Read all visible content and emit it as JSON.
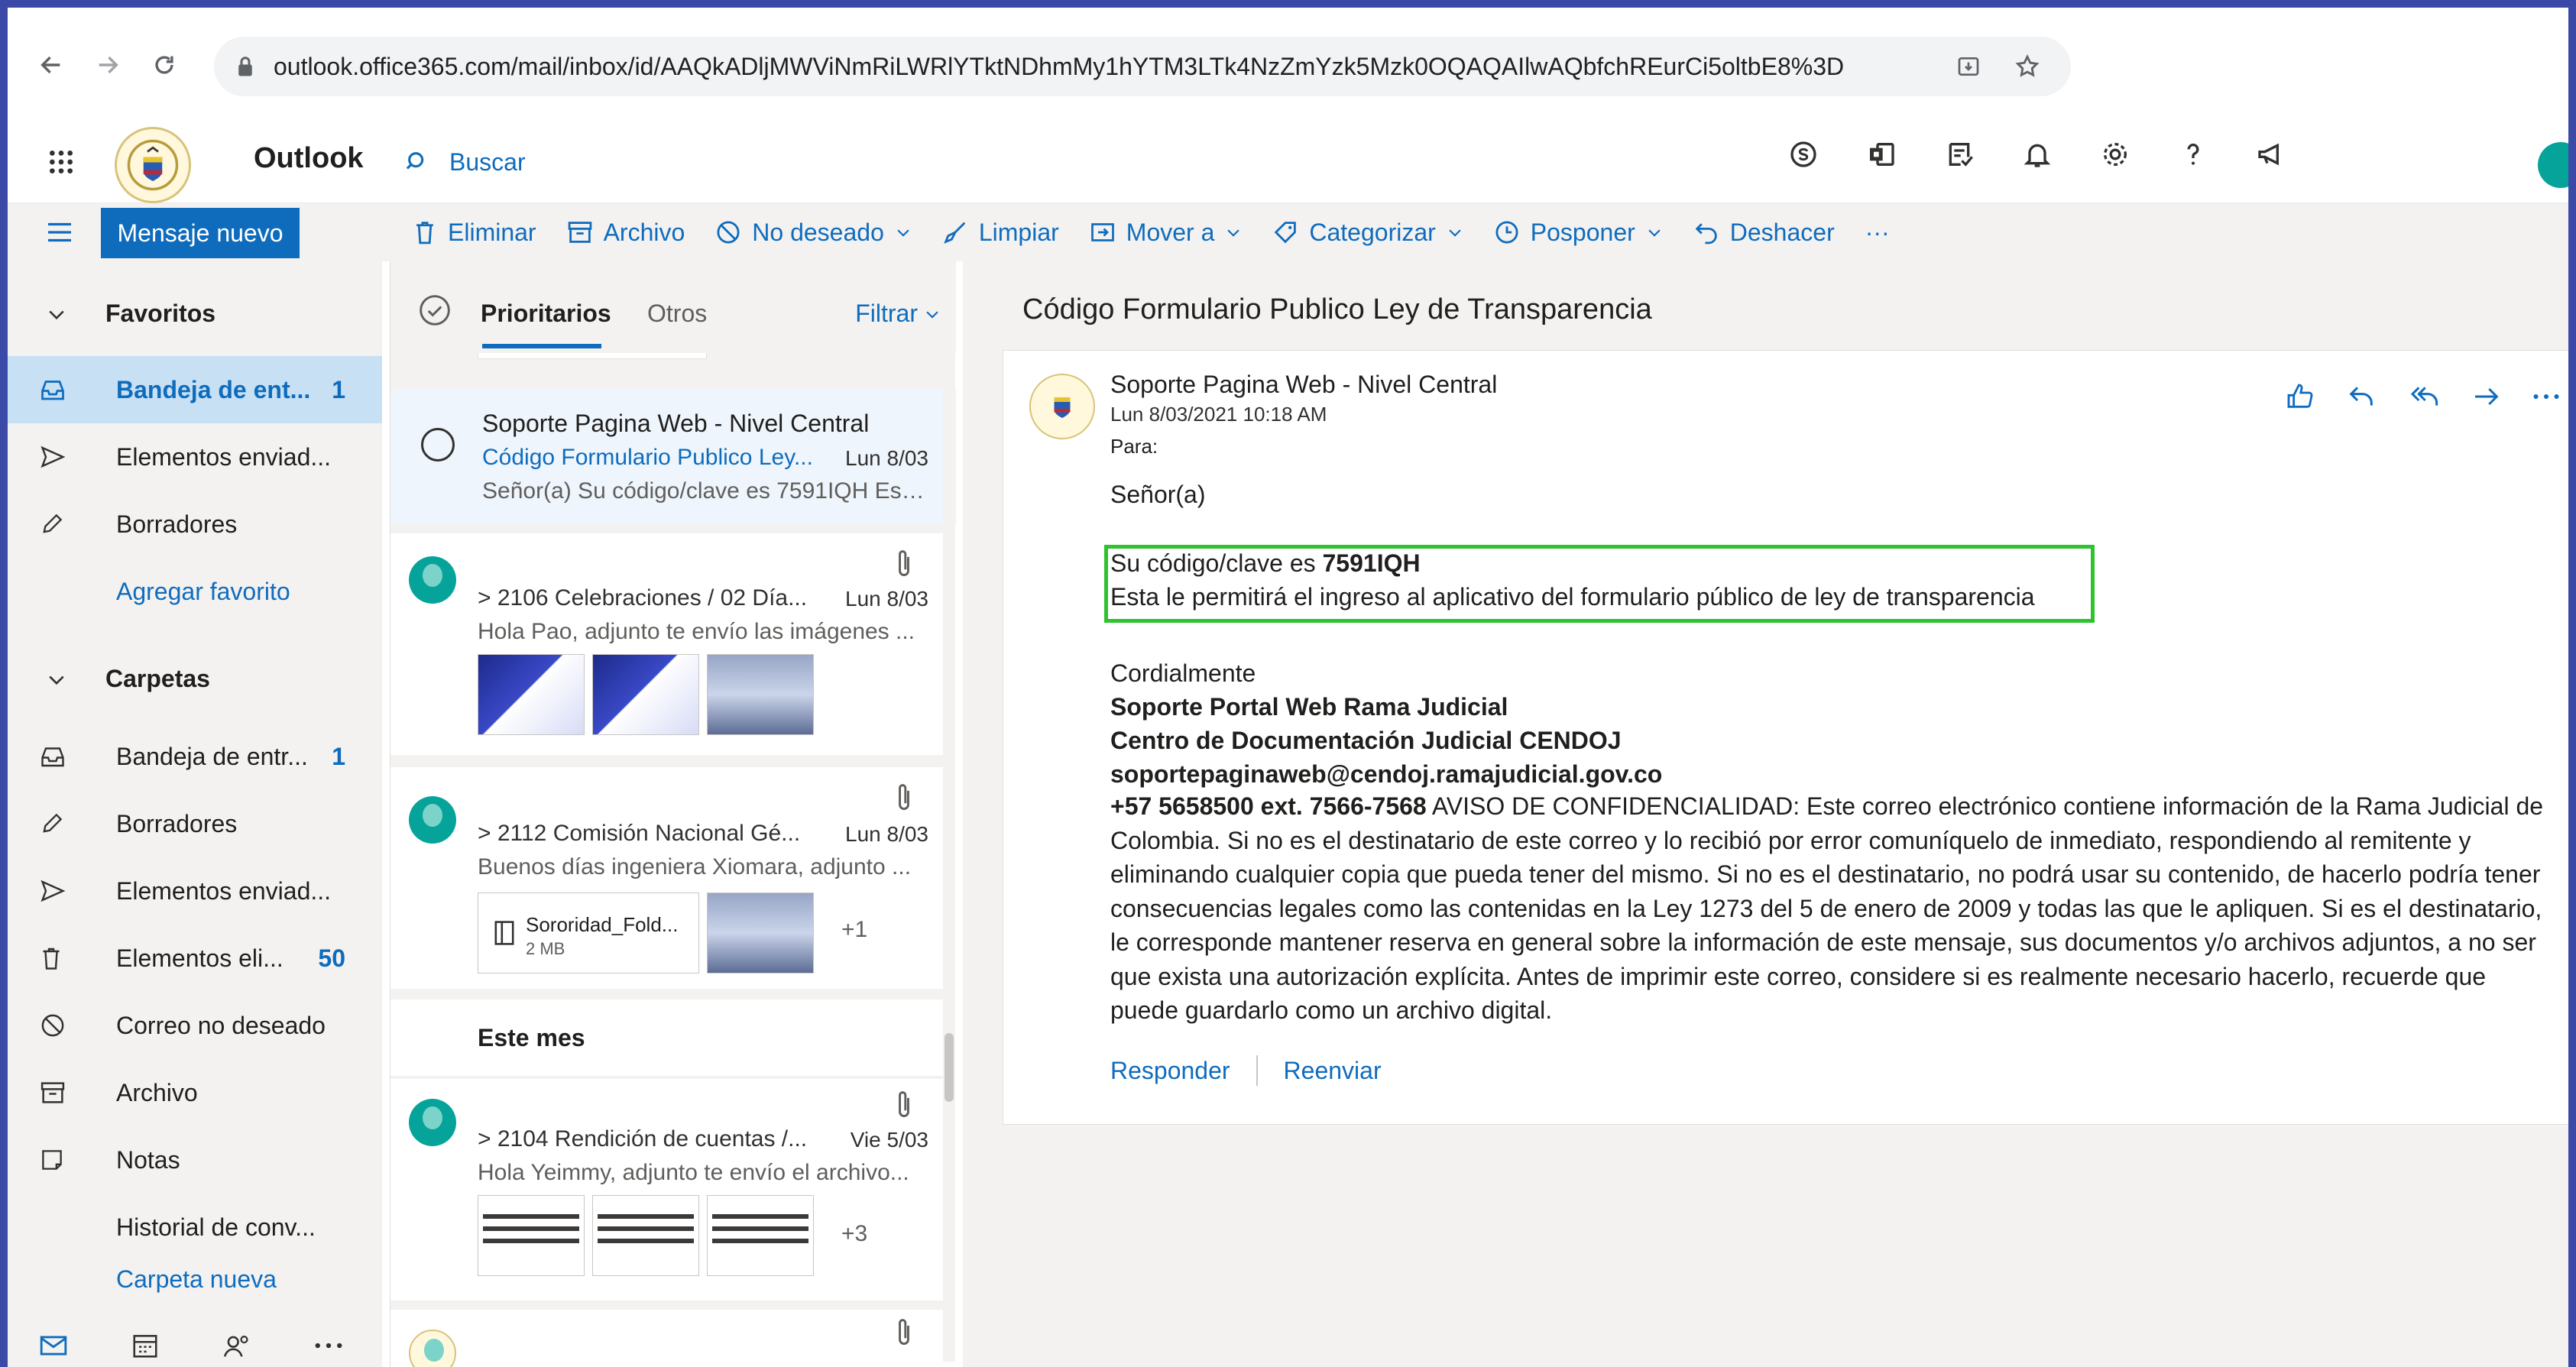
{
  "browser": {
    "url": "outlook.office365.com/mail/inbox/id/AAQkADljMWViNmRiLWRlYTktNDhmMy1hYTM3LTk4NzZmYzk5Mzk0OQAQAIlwAQbfchREurCi5oltbE8%3D"
  },
  "header": {
    "app_name": "Outlook",
    "search_label": "Buscar"
  },
  "commandbar": {
    "new_message": "Mensaje nuevo",
    "delete": "Eliminar",
    "archive": "Archivo",
    "junk": "No deseado",
    "sweep": "Limpiar",
    "move_to": "Mover a",
    "categorize": "Categorizar",
    "snooze": "Posponer",
    "undo": "Deshacer",
    "more": "···"
  },
  "nav": {
    "favorites_label": "Favoritos",
    "favorites": [
      {
        "label": "Bandeja de ent...",
        "count": "1"
      },
      {
        "label": "Elementos enviad...",
        "count": ""
      },
      {
        "label": "Borradores",
        "count": ""
      },
      {
        "label": "Agregar favorito",
        "count": ""
      }
    ],
    "folders_label": "Carpetas",
    "folders": [
      {
        "label": "Bandeja de entr...",
        "count": "1"
      },
      {
        "label": "Borradores",
        "count": ""
      },
      {
        "label": "Elementos enviad...",
        "count": ""
      },
      {
        "label": "Elementos eli...",
        "count": "50"
      },
      {
        "label": "Correo no deseado",
        "count": ""
      },
      {
        "label": "Archivo",
        "count": ""
      },
      {
        "label": "Notas",
        "count": ""
      },
      {
        "label": "Historial de conv...",
        "count": ""
      },
      {
        "label": "Carpeta nueva",
        "count": ""
      }
    ]
  },
  "list": {
    "tab_focused": "Prioritarios",
    "tab_other": "Otros",
    "filter": "Filtrar",
    "messages": [
      {
        "sender": "Soporte Pagina Web - Nivel Central",
        "subject": "Código Formulario Publico Ley...",
        "date": "Lun 8/03",
        "preview": "Señor(a) Su código/clave es 7591IQH Est..."
      },
      {
        "sender": "",
        "subject": "> 2106 Celebraciones / 02 Día...",
        "date": "Lun 8/03",
        "preview": "Hola Pao, adjunto te envío las imágenes ..."
      },
      {
        "sender": "",
        "subject": "> 2112 Comisión Nacional Gé...",
        "date": "Lun 8/03",
        "preview": "Buenos días ingeniera Xiomara, adjunto ...",
        "file_name": "Sororidad_Fold...",
        "file_size": "2 MB",
        "extra": "+1"
      },
      {
        "sender": "",
        "subject": "> 2104 Rendición de cuentas /...",
        "date": "Vie 5/03",
        "preview": "Hola Yeimmy, adjunto te envío el archivo...",
        "extra": "+3"
      }
    ],
    "section_this_month": "Este mes"
  },
  "reading": {
    "subject": "Código Formulario Publico Ley de Transparencia",
    "from": "Soporte Pagina Web - Nivel Central",
    "datetime": "Lun 8/03/2021 10:18 AM",
    "to_label": "Para:",
    "greeting": "Señor(a)",
    "code_prefix": "Su código/clave es ",
    "code": "7591IQH",
    "code_note": "Esta le permitirá el ingreso al aplicativo del formulario público de ley de transparencia",
    "closing": "Cordialmente",
    "sig1": "Soporte Portal Web Rama Judicial",
    "sig2": "Centro de Documentación Judicial CENDOJ",
    "sig_email": "soportepaginaweb@cendoj.ramajudicial.gov.co",
    "sig_phone": "+57 5658500 ext. 7566-7568",
    "disclaimer": " AVISO DE CONFIDENCIALIDAD: Este correo electrónico contiene información de la Rama Judicial de Colombia. Si no es el destinatario de este correo y lo recibió por error comuníquelo de inmediato, respondiendo al remitente y eliminando cualquier copia que pueda tener del mismo. Si no es el destinatario, no podrá usar su contenido, de hacerlo podría tener consecuencias legales como las contenidas en la Ley 1273 del 5 de enero de 2009 y todas las que le apliquen. Si es el destinatario, le corresponde mantener reserva en general sobre la información de este mensaje, sus documentos y/o archivos adjuntos, a no ser que exista una autorización explícita. Antes de imprimir este correo, considere si es realmente necesario hacerlo, recuerde que puede guardarlo como un archivo digital.",
    "reply": "Responder",
    "forward": "Reenviar"
  },
  "colors": {
    "accent": "#0f6cbd",
    "highlight_box": "#2fc22f",
    "frame": "#3b4aa6"
  }
}
